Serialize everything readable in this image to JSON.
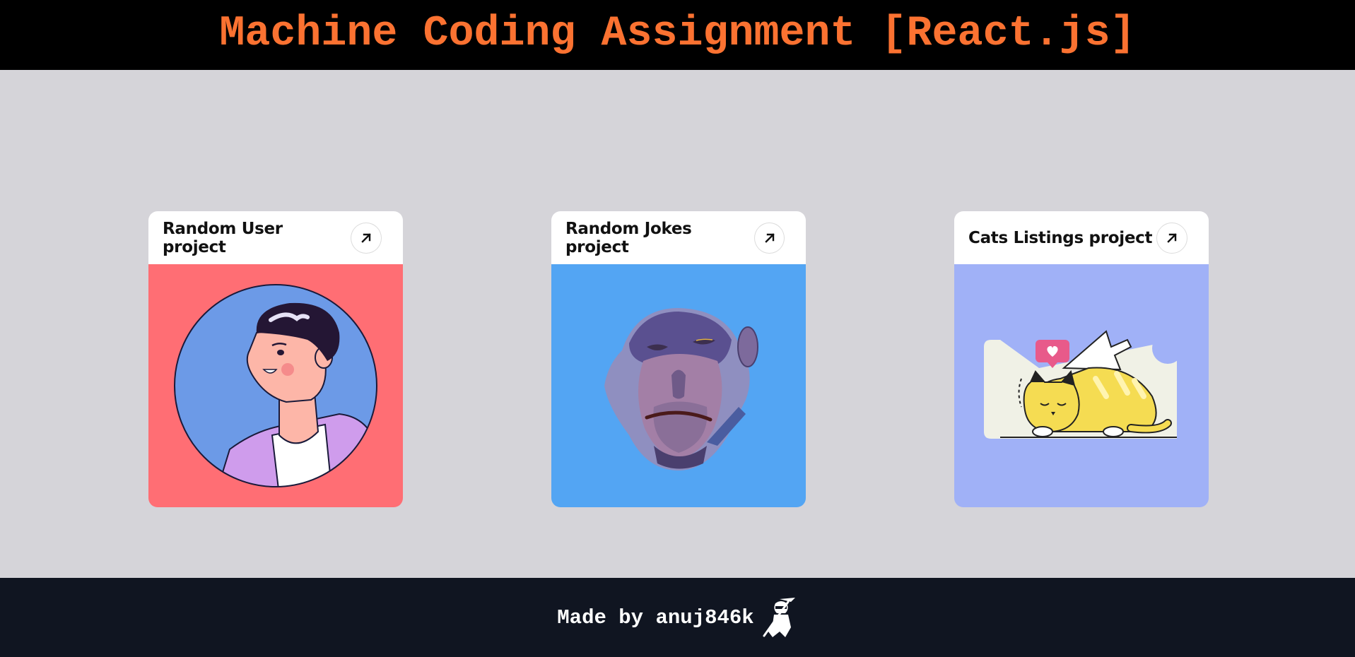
{
  "header": {
    "title": "Machine Coding Assignment [React.js]"
  },
  "cards": [
    {
      "title": "Random User project",
      "image": "user-avatar-illustration",
      "bg": "#ff6e74",
      "icon": "arrow-up-right-icon"
    },
    {
      "title": "Random Jokes project",
      "image": "monkey-face-illustration",
      "bg": "#53a5f3",
      "icon": "arrow-up-right-icon"
    },
    {
      "title": "Cats Listings project",
      "image": "sleeping-cat-illustration",
      "bg": "#a0b1f7",
      "icon": "arrow-up-right-icon"
    }
  ],
  "footer": {
    "text": "Made by anuj846k",
    "icon": "ninja-icon"
  },
  "colors": {
    "accent": "#fb7231",
    "header_bg": "#000000",
    "page_bg": "#d5d4d9",
    "footer_bg": "#101521"
  }
}
